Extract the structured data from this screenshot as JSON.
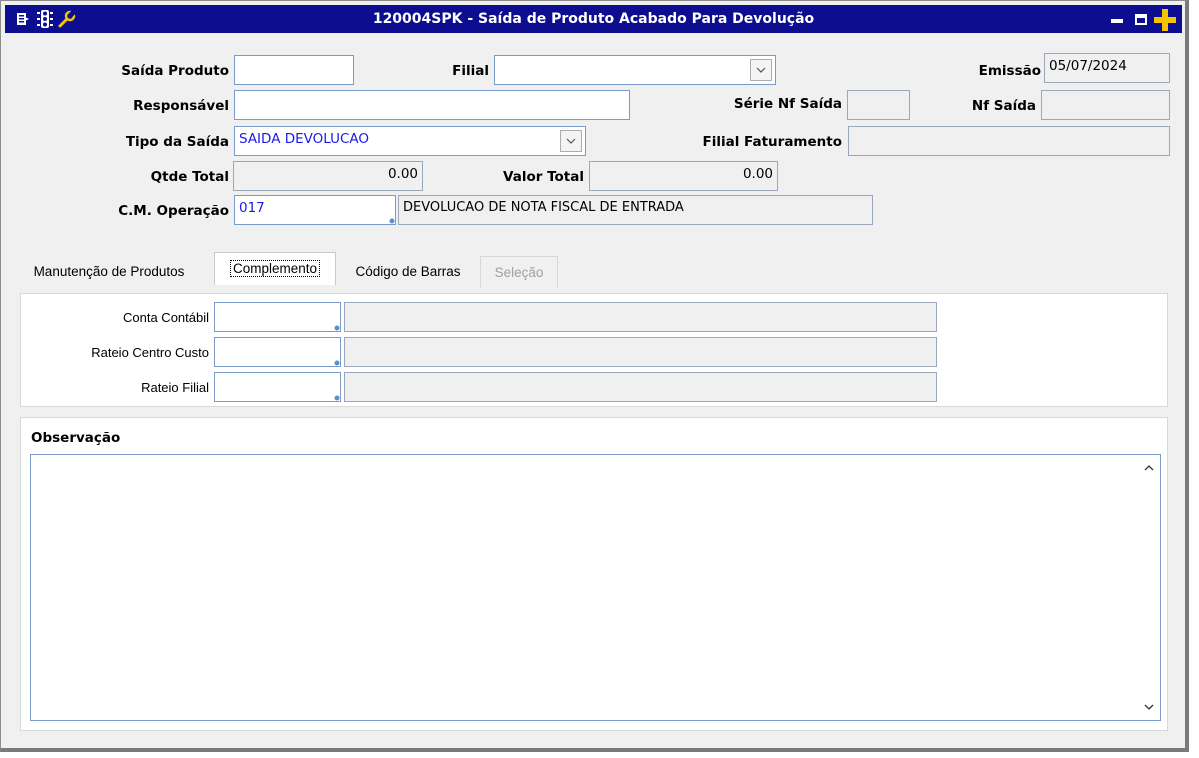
{
  "window": {
    "title": "120004SPK - Saída de Produto Acabado Para Devolução"
  },
  "header": {
    "saida_produto": {
      "label": "Saída Produto",
      "value": ""
    },
    "filial": {
      "label": "Filial",
      "value": ""
    },
    "emissao": {
      "label": "Emissão",
      "value": "05/07/2024"
    },
    "responsavel": {
      "label": "Responsável",
      "value": ""
    },
    "serie_nf_saida": {
      "label": "Série Nf Saída",
      "value": ""
    },
    "nf_saida": {
      "label": "Nf Saída",
      "value": ""
    },
    "tipo_saida": {
      "label": "Tipo da Saída",
      "value": "SAIDA DEVOLUCAO"
    },
    "filial_faturamento": {
      "label": "Filial Faturamento",
      "value": ""
    },
    "qtde_total": {
      "label": "Qtde Total",
      "value": "0.00"
    },
    "valor_total": {
      "label": "Valor Total",
      "value": "0.00"
    },
    "cm_operacao": {
      "label": "C.M. Operação",
      "code": "017",
      "description": "DEVOLUCAO DE NOTA FISCAL DE ENTRADA"
    }
  },
  "tabs": [
    {
      "label": "Manutenção de Produtos",
      "state": "normal"
    },
    {
      "label": "Complemento",
      "state": "active"
    },
    {
      "label": "Código de Barras",
      "state": "normal"
    },
    {
      "label": "Seleção",
      "state": "disabled"
    }
  ],
  "complemento": {
    "conta_contabil": {
      "label": "Conta Contábil",
      "code": "",
      "description": ""
    },
    "rateio_centro_custo": {
      "label": "Rateio Centro Custo",
      "code": "",
      "description": ""
    },
    "rateio_filial": {
      "label": "Rateio Filial",
      "code": "",
      "description": ""
    }
  },
  "observacao": {
    "label": "Observação",
    "value": ""
  },
  "colors": {
    "titlebar": "#0d0d8f",
    "field_border": "#7a9cc6",
    "value_blue": "#1a1ae6",
    "plus_icon": "#f5c400"
  }
}
